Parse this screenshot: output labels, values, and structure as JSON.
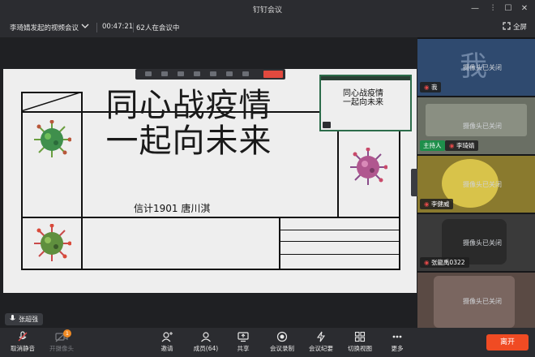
{
  "window": {
    "title": "钉钉会议"
  },
  "info": {
    "meeting_name": "李琦婧发起的视频会议",
    "elapsed": "00:47:21",
    "participants_status": "62人在会议中",
    "fullscreen_label": "全屏"
  },
  "slide": {
    "title_line1": "同心战疫情",
    "title_line2": "一起向未来",
    "author": "信计1901 唐川淇"
  },
  "pip": {
    "title_line1": "同心战疫情",
    "title_line2": "一起向未来"
  },
  "active_speaker": "张超强",
  "participants": [
    {
      "name": "我",
      "status": "摄像头已关闭",
      "avatar_char": "我"
    },
    {
      "name": "李琦婧",
      "status": "摄像头已关闭",
      "role": "主持人"
    },
    {
      "name": "李健威",
      "status": "摄像头已关闭"
    },
    {
      "name": "张龍禹0322",
      "status": "摄像头已关闭"
    },
    {
      "name": "",
      "status": "摄像头已关闭"
    }
  ],
  "toolbar": {
    "mute_label": "取消静音",
    "camera_label": "开摄像头",
    "camera_badge": "1",
    "invite_label": "邀请",
    "members_label": "成员(64)",
    "share_label": "共享",
    "record_label": "会议录制",
    "minutes_label": "会议纪要",
    "switch_view_label": "切换视图",
    "more_label": "更多",
    "leave_label": "离开"
  },
  "colors": {
    "leave": "#f04b23",
    "host_badge": "#1e8f4b",
    "badge": "#f08a24"
  }
}
